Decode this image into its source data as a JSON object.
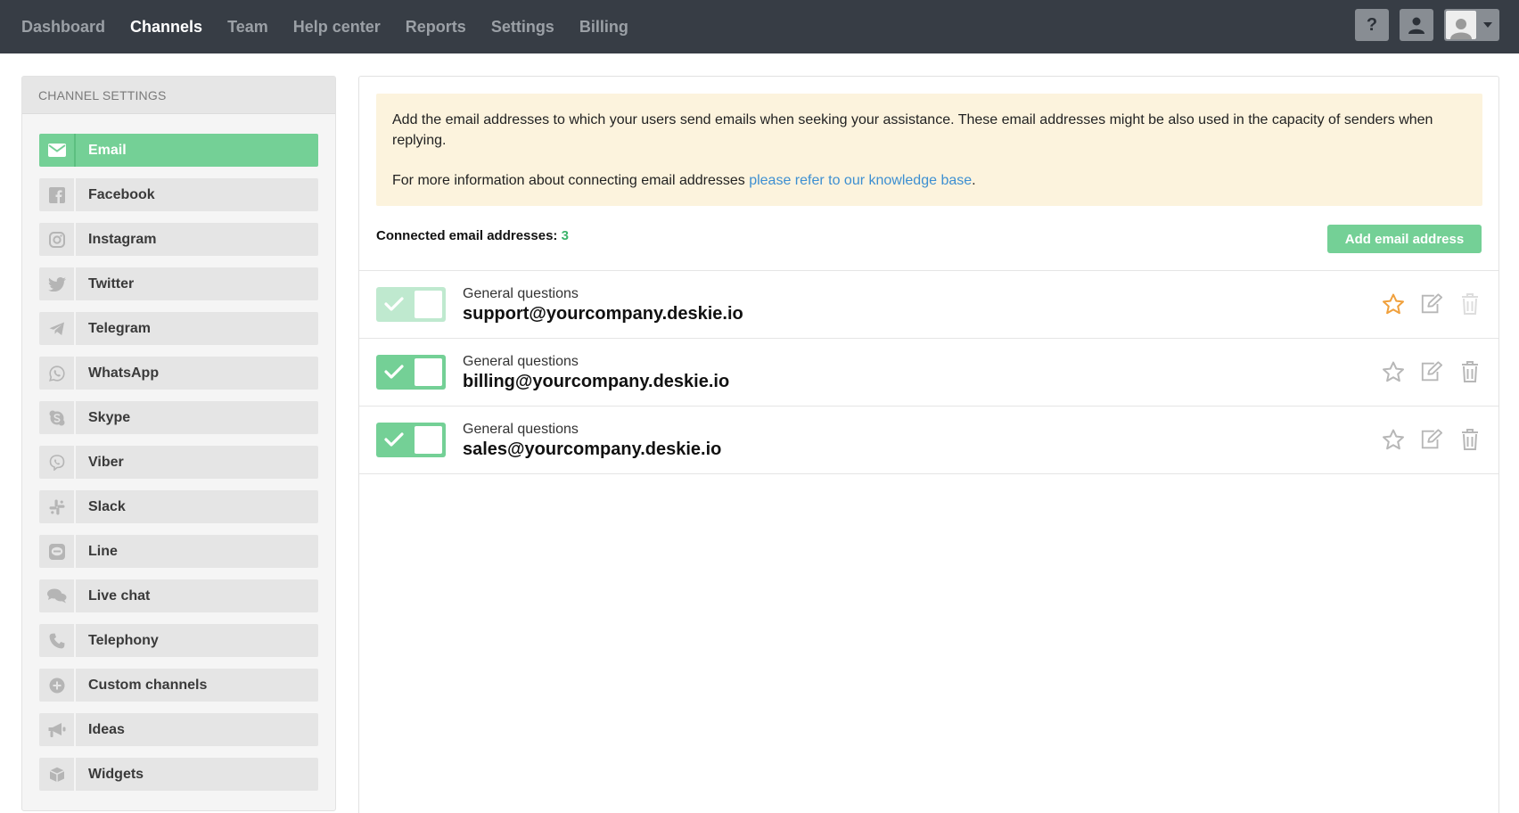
{
  "nav": {
    "items": [
      {
        "label": "Dashboard",
        "active": false
      },
      {
        "label": "Channels",
        "active": true
      },
      {
        "label": "Team",
        "active": false
      },
      {
        "label": "Help center",
        "active": false
      },
      {
        "label": "Reports",
        "active": false
      },
      {
        "label": "Settings",
        "active": false
      },
      {
        "label": "Billing",
        "active": false
      }
    ],
    "help_label": "?",
    "icons": [
      "question-icon",
      "user-icon",
      "avatar-icon"
    ]
  },
  "sidebar": {
    "title": "CHANNEL SETTINGS",
    "items": [
      {
        "label": "Email",
        "icon": "envelope-icon",
        "active": true
      },
      {
        "label": "Facebook",
        "icon": "facebook-icon",
        "active": false
      },
      {
        "label": "Instagram",
        "icon": "instagram-icon",
        "active": false
      },
      {
        "label": "Twitter",
        "icon": "twitter-icon",
        "active": false
      },
      {
        "label": "Telegram",
        "icon": "telegram-icon",
        "active": false
      },
      {
        "label": "WhatsApp",
        "icon": "whatsapp-icon",
        "active": false
      },
      {
        "label": "Skype",
        "icon": "skype-icon",
        "active": false
      },
      {
        "label": "Viber",
        "icon": "viber-icon",
        "active": false
      },
      {
        "label": "Slack",
        "icon": "slack-icon",
        "active": false
      },
      {
        "label": "Line",
        "icon": "line-icon",
        "active": false
      },
      {
        "label": "Live chat",
        "icon": "chat-icon",
        "active": false
      },
      {
        "label": "Telephony",
        "icon": "phone-icon",
        "active": false
      },
      {
        "label": "Custom channels",
        "icon": "plus-circle-icon",
        "active": false
      },
      {
        "label": "Ideas",
        "icon": "megaphone-icon",
        "active": false
      },
      {
        "label": "Widgets",
        "icon": "cube-icon",
        "active": false
      }
    ]
  },
  "main": {
    "notice": {
      "line1": "Add the email addresses to which your users send emails when seeking your assistance. These email addresses might be also used in the capacity of senders when replying.",
      "line2_prefix": "For more information about connecting email addresses ",
      "link_text": "please refer to our knowledge base",
      "line2_suffix": "."
    },
    "connected_label": "Connected email addresses:",
    "connected_count": "3",
    "add_button": "Add email address",
    "emails": [
      {
        "group": "General questions",
        "address": "support@yourcompany.deskie.io",
        "enabled": true,
        "primary": true
      },
      {
        "group": "General questions",
        "address": "billing@yourcompany.deskie.io",
        "enabled": true,
        "primary": false
      },
      {
        "group": "General questions",
        "address": "sales@yourcompany.deskie.io",
        "enabled": true,
        "primary": false
      }
    ]
  },
  "colors": {
    "topbar": "#373d45",
    "accent_green": "#74d096",
    "count_green": "#3bb36a",
    "notice_bg": "#fcf3dd",
    "link_blue": "#3d8fd1",
    "star_active": "#f0a03c"
  }
}
